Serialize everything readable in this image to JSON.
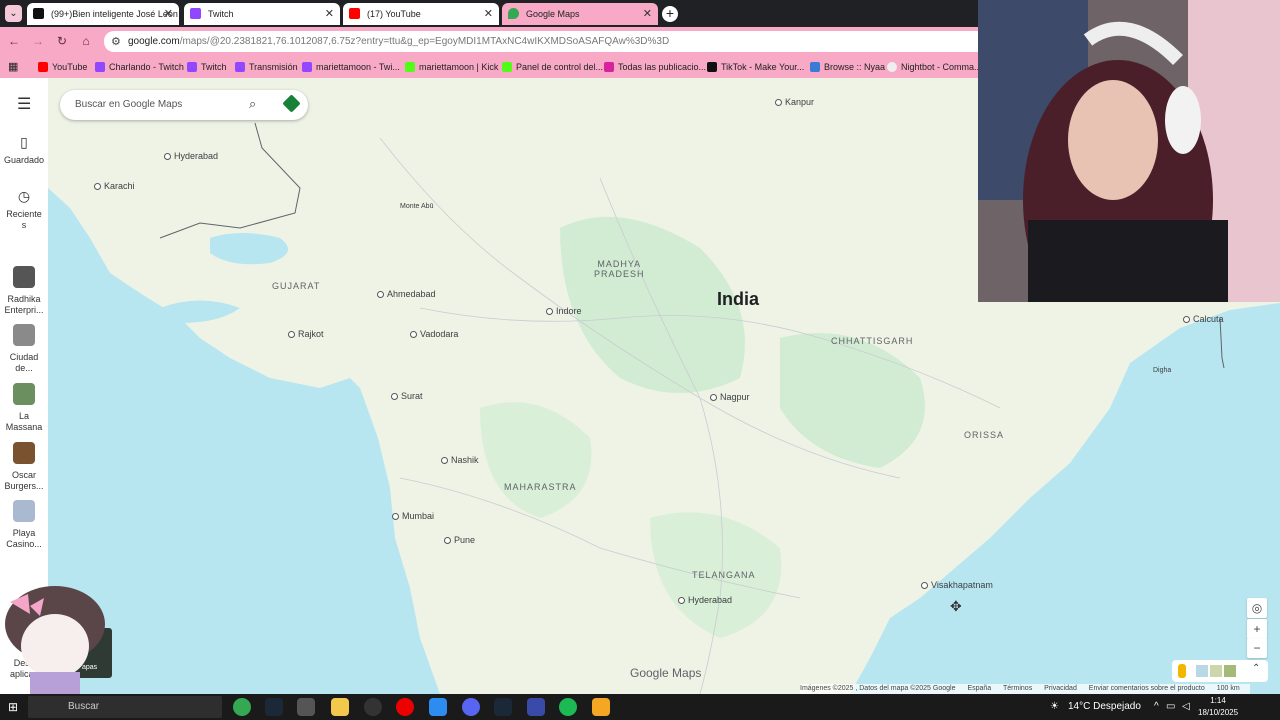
{
  "browser": {
    "tabs": [
      {
        "title": "(99+)Bien inteligente José Leon",
        "active": false
      },
      {
        "title": "Twitch",
        "active": false
      },
      {
        "title": "(17) YouTube",
        "active": false
      },
      {
        "title": "Google Maps",
        "active": true
      }
    ],
    "url_host": "google.com",
    "url_path": "/maps/@20.2381821,76.1012087,6.75z?entry=ttu&g_ep=EgoyMDI1MTAxNC4wIKXMDSoASAFQAw%3D%3D",
    "bookmarks": [
      "YouTube",
      "Charlando - Twitch",
      "Twitch",
      "Transmisión",
      "mariettamoon - Twi...",
      "mariettamoon | Kick",
      "Panel de control del...",
      "Todas las publicacio...",
      "TikTok - Make Your...",
      "Browse :: Nyaa",
      "Nightbot - Comma..."
    ]
  },
  "maps": {
    "search_placeholder": "Buscar en Google Maps",
    "rail": {
      "saved_label": "Guardado",
      "recent_label": "Reciente\ns",
      "recent_places": [
        "Radhika\nEnterpri...",
        "Ciudad\nde...",
        "La\nMassana",
        "Oscar\nBurgers...",
        "Playa\nCasino..."
      ],
      "bottom_label": "Desc\naplicac"
    },
    "country_label": "India",
    "state_labels": [
      "GUJARAT",
      "MADHYA\nPRADESH",
      "CHHATTISGARH",
      "ORISSA",
      "MAHARASTRA",
      "TELANGANA"
    ],
    "city_labels": [
      "Hyderabad",
      "Karachi",
      "Monte Abū",
      "Ahmedabad",
      "Rajkot",
      "Vadodara",
      "Indore",
      "Surat",
      "Nagpur",
      "Nashik",
      "Mumbai",
      "Pune",
      "Hyderabad",
      "Visakhapatnam",
      "Kanpur",
      "Calcuta",
      "Digha"
    ],
    "logo_text": "Google Maps",
    "footer": [
      "Imágenes ©2025 , Datos del mapa ©2025 Google",
      "España",
      "Términos",
      "Privacidad",
      "Enviar comentarios sobre el producto",
      "100 km"
    ],
    "layers_label": "Capas"
  },
  "taskbar": {
    "search_placeholder": "Buscar",
    "weather": "14°C  Despejado",
    "time": "1:14",
    "date": "18/10/2025"
  },
  "colors": {
    "browser_accent": "#f7a9c5",
    "water": "#b8e6f0",
    "land": "#eef3e6",
    "forest": "#d2ecd3"
  }
}
